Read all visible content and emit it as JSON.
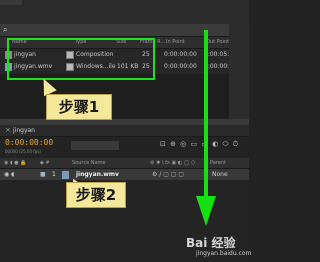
{
  "project_panel": {
    "columns": [
      "Name",
      "Type",
      "Size",
      "Frame R...",
      "In Point",
      "Out Point"
    ],
    "rows": [
      {
        "name": "jingyan",
        "type": "Composition",
        "size": "",
        "frame_rate": "25",
        "in_point": "0:00:00:00",
        "out_point": "0:00:05:00"
      },
      {
        "name": "jingyan.wmv",
        "type": "Windows...ile",
        "size": "101 KB",
        "frame_rate": "25",
        "in_point": "0:00:00:00",
        "out_point": "0:00:00:00"
      }
    ]
  },
  "annotations": {
    "step1": "步骤1",
    "step2": "步骤2"
  },
  "timeline": {
    "tab_label": "jingyan",
    "timecode": "0:00:00:00",
    "fps_label": "00000 (25.00 fps)",
    "columns": {
      "source_name": "Source Name",
      "parent": "Parent"
    },
    "layer": {
      "index": "1",
      "name": "jingyan.wmv",
      "parent_value": "None"
    }
  },
  "watermark": {
    "brand": "Bai 经验",
    "url": "jingyan.baidu.com"
  },
  "colors": {
    "annotation_green": "#15e012",
    "callout_fill": "#f6e89b",
    "timecode_orange": "#e6a22a"
  }
}
